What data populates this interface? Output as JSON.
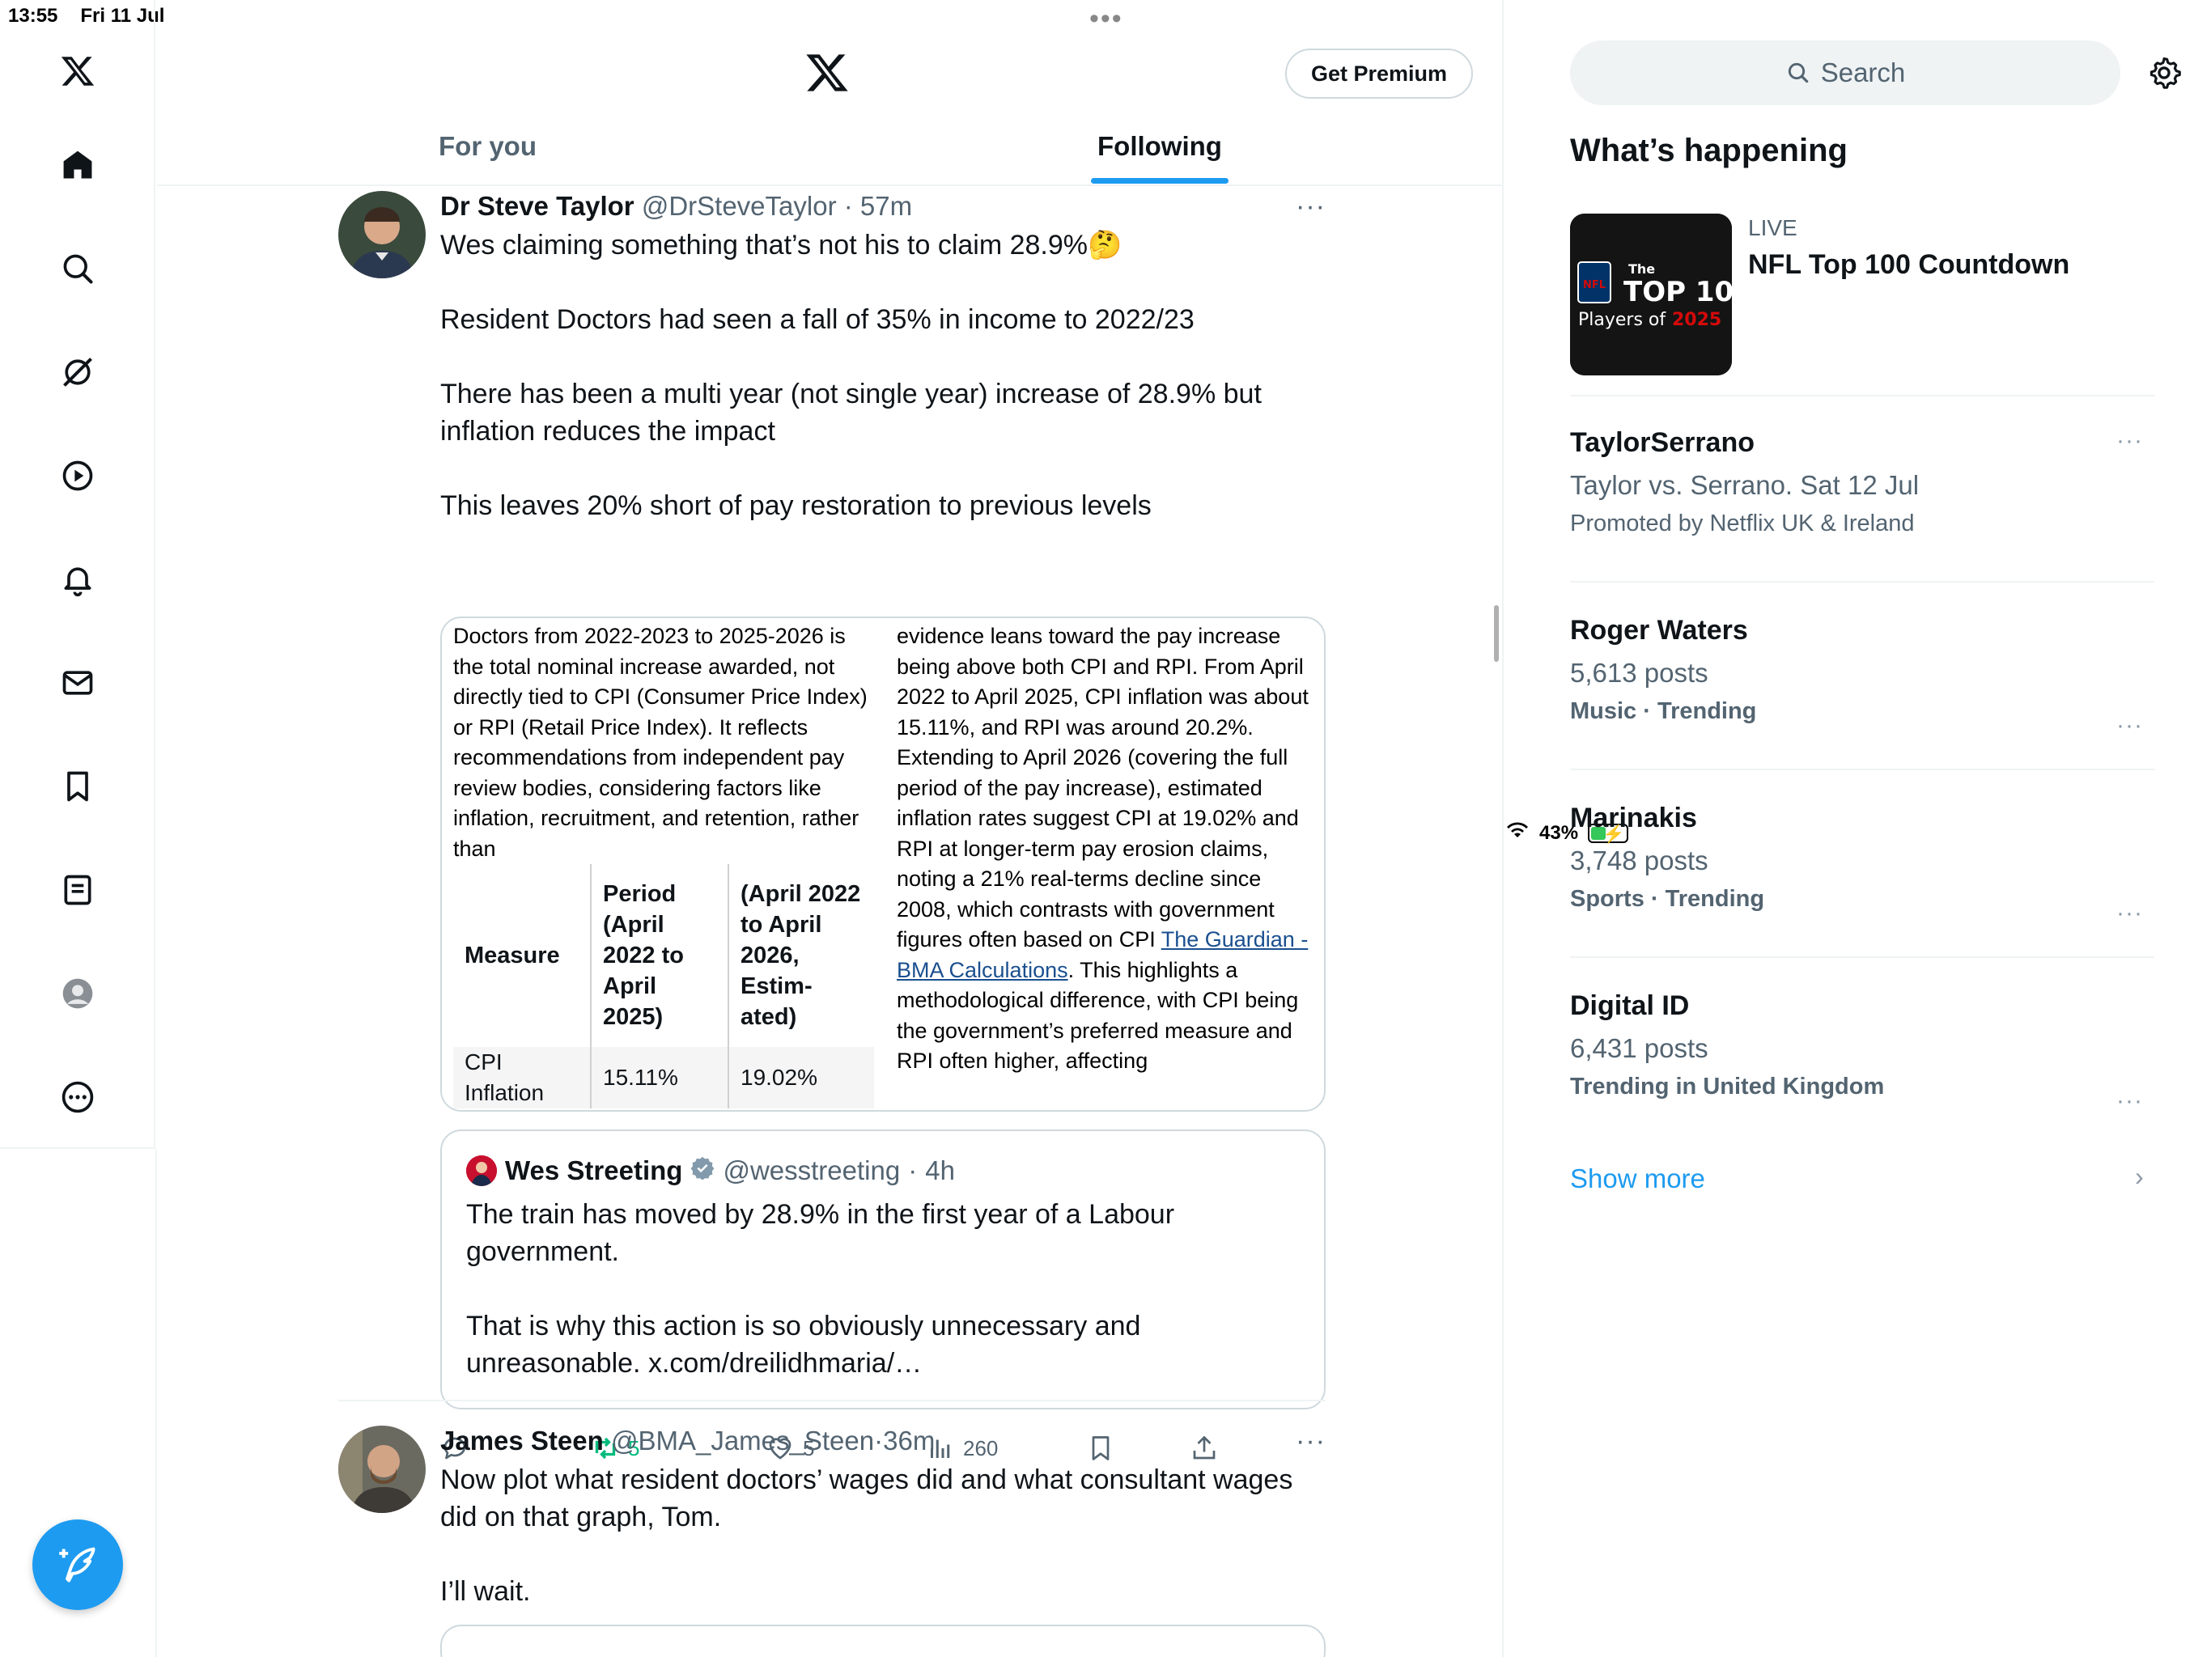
{
  "status_bar": {
    "time": "13:55",
    "date": "Fri 11 Jul",
    "battery_percent": "43%",
    "battery_level": 0.43
  },
  "header": {
    "get_premium_label": "Get Premium"
  },
  "tabs": [
    {
      "label": "For you",
      "selected": false
    },
    {
      "label": "Following",
      "selected": true
    }
  ],
  "tweets": [
    {
      "name": "Dr Steve Taylor",
      "handle": "@DrSteveTaylor",
      "time": "57m",
      "paragraphs": [
        "Wes claiming something that’s not his to claim 28.9%🤔",
        "Resident Doctors had seen a fall of 35% in income to 2022/23",
        "There has been a multi year (not single year) increase of 28.9% but inflation reduces the impact",
        "This leaves 20% short of pay restoration to previous levels"
      ],
      "image_left_text": "Doctors from 2022-2023 to 2025-2026 is the total nominal increase awarded, not directly tied to CPI (Consumer Price Index) or RPI (Retail Price Index). It reflects recommendations from independent pay review bodies, considering factors like inflation, recruitment, and retention, rather than",
      "image_table": {
        "headers": [
          "Measure",
          "Period (April 2022 to April 2025)",
          "(April 2022 to April 2026, Estim-ated)"
        ],
        "row": [
          "CPI Inflation",
          "15.11%",
          "19.02%"
        ]
      },
      "image_right_text_a": "evidence leans toward the pay increase being above both CPI and RPI. From April 2022 to April 2025, CPI inflation was about 15.11%, and RPI was around 20.2%. Extending to April 2026 (covering the full period of the pay increase), estimated inflation rates suggest CPI at 19.02% and RPI at longer-term pay erosion claims, noting a 21% real-terms decline since 2008, which contrasts with government figures often based on CPI ",
      "image_right_link": "The Guardian - BMA Calculations",
      "image_right_text_b": ". This highlights a methodological difference, with CPI being the government’s preferred measure and RPI often higher, affecting",
      "quote": {
        "name": "Wes Streeting",
        "handle": "@wesstreeting",
        "time": "4h",
        "paragraphs": [
          "The train has moved by 28.9% in the first year of a Labour government.",
          "That is why this action is so obviously unnecessary and unreasonable. x.com/dreilidhmaria/…"
        ]
      },
      "actions": {
        "retweets": "5",
        "likes": "5",
        "views": "260"
      }
    },
    {
      "name": "James Steen",
      "handle": "@BMA_James_Steen",
      "time": "36m",
      "paragraphs": [
        "Now plot what resident doctors’ wages did and what consultant wages did on that graph, Tom.",
        "I’ll wait."
      ]
    }
  ],
  "sidebar": {
    "search_placeholder": "Search",
    "section_title": "What’s happening",
    "live": {
      "label": "LIVE",
      "title": "NFL Top 100 Countdown",
      "thumb_small": "The",
      "thumb_big": "TOP 100",
      "thumb_players": "Players of",
      "thumb_year": "2025",
      "thumb_logo": "NFL"
    },
    "trends": [
      {
        "title": "TaylorSerrano",
        "line2": "Taylor vs. Serrano. Sat 12 Jul",
        "line3": "Promoted by Netflix UK & Ireland",
        "promoted": true
      },
      {
        "title": "Roger Waters",
        "line2": "5,613 posts",
        "line3": "Music · Trending",
        "promoted": false
      },
      {
        "title": "Marinakis",
        "line2": "3,748 posts",
        "line3": "Sports · Trending",
        "promoted": false
      },
      {
        "title": "Digital ID",
        "line2": "6,431 posts",
        "line3": "Trending in United Kingdom",
        "promoted": false
      }
    ],
    "show_more": "Show more"
  },
  "colors": {
    "accent": "#1d9bf0",
    "retweet_green": "#00ba7c",
    "secondary_text": "#536471"
  }
}
